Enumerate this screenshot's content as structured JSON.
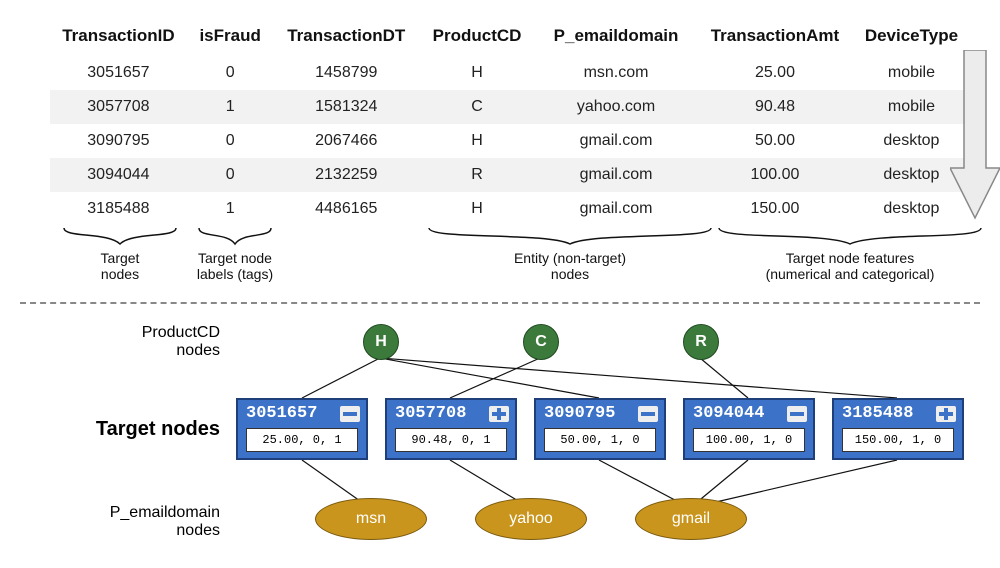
{
  "table": {
    "columns": [
      "TransactionID",
      "isFraud",
      "TransactionDT",
      "ProductCD",
      "P_emaildomain",
      "TransactionAmt",
      "DeviceType"
    ],
    "rows": [
      {
        "tid": "3051657",
        "fraud": "0",
        "dt": "1458799",
        "pcd": "H",
        "email": "msn.com",
        "amt": "25.00",
        "dev": "mobile"
      },
      {
        "tid": "3057708",
        "fraud": "1",
        "dt": "1581324",
        "pcd": "C",
        "email": "yahoo.com",
        "amt": "90.48",
        "dev": "mobile"
      },
      {
        "tid": "3090795",
        "fraud": "0",
        "dt": "2067466",
        "pcd": "H",
        "email": "gmail.com",
        "amt": "50.00",
        "dev": "desktop"
      },
      {
        "tid": "3094044",
        "fraud": "0",
        "dt": "2132259",
        "pcd": "R",
        "email": "gmail.com",
        "amt": "100.00",
        "dev": "desktop"
      },
      {
        "tid": "3185488",
        "fraud": "1",
        "dt": "4486165",
        "pcd": "H",
        "email": "gmail.com",
        "amt": "150.00",
        "dev": "desktop"
      }
    ]
  },
  "braces": {
    "target_nodes": "Target\nnodes",
    "target_labels": "Target node\nlabels (tags)",
    "entity_nodes": "Entity (non-target)\nnodes",
    "target_features": "Target node features\n(numerical and categorical)"
  },
  "graph": {
    "row_labels": {
      "pcd": "ProductCD\nnodes",
      "target": "Target nodes",
      "email": "P_emaildomain\nnodes"
    },
    "pcd_nodes": [
      "H",
      "C",
      "R"
    ],
    "target_nodes": [
      {
        "id": "3051657",
        "mark": "minus",
        "feat": "25.00, 0, 1"
      },
      {
        "id": "3057708",
        "mark": "plus",
        "feat": "90.48, 0, 1"
      },
      {
        "id": "3090795",
        "mark": "minus",
        "feat": "50.00, 1, 0"
      },
      {
        "id": "3094044",
        "mark": "minus",
        "feat": "100.00, 1, 0"
      },
      {
        "id": "3185488",
        "mark": "plus",
        "feat": "150.00, 1, 0"
      }
    ],
    "email_nodes": [
      "msn",
      "yahoo",
      "gmail"
    ]
  },
  "chart_data": {
    "type": "table",
    "title": "Tabular-to-graph mapping example",
    "columns": [
      "TransactionID",
      "isFraud",
      "TransactionDT",
      "ProductCD",
      "P_emaildomain",
      "TransactionAmt",
      "DeviceType"
    ],
    "column_roles": {
      "TransactionID": "target_node",
      "isFraud": "target_label",
      "TransactionDT": "unused",
      "ProductCD": "entity_node",
      "P_emaildomain": "entity_node",
      "TransactionAmt": "target_feature_numeric",
      "DeviceType": "target_feature_categorical"
    },
    "data": [
      {
        "TransactionID": 3051657,
        "isFraud": 0,
        "TransactionDT": 1458799,
        "ProductCD": "H",
        "P_emaildomain": "msn.com",
        "TransactionAmt": 25.0,
        "DeviceType": "mobile"
      },
      {
        "TransactionID": 3057708,
        "isFraud": 1,
        "TransactionDT": 1581324,
        "ProductCD": "C",
        "P_emaildomain": "yahoo.com",
        "TransactionAmt": 90.48,
        "DeviceType": "mobile"
      },
      {
        "TransactionID": 3090795,
        "isFraud": 0,
        "TransactionDT": 2067466,
        "ProductCD": "H",
        "P_emaildomain": "gmail.com",
        "TransactionAmt": 50.0,
        "DeviceType": "desktop"
      },
      {
        "TransactionID": 3094044,
        "isFraud": 0,
        "TransactionDT": 2132259,
        "ProductCD": "R",
        "P_emaildomain": "gmail.com",
        "TransactionAmt": 100.0,
        "DeviceType": "desktop"
      },
      {
        "TransactionID": 3185488,
        "isFraud": 1,
        "TransactionDT": 4486165,
        "ProductCD": "H",
        "P_emaildomain": "gmail.com",
        "TransactionAmt": 150.0,
        "DeviceType": "desktop"
      }
    ],
    "graph": {
      "target_nodes": [
        3051657,
        3057708,
        3090795,
        3094044,
        3185488
      ],
      "target_node_features": {
        "3051657": [
          25.0,
          0,
          1
        ],
        "3057708": [
          90.48,
          0,
          1
        ],
        "3090795": [
          50.0,
          1,
          0
        ],
        "3094044": [
          100.0,
          1,
          0
        ],
        "3185488": [
          150.0,
          1,
          0
        ]
      },
      "target_node_labels": {
        "3051657": 0,
        "3057708": 1,
        "3090795": 0,
        "3094044": 0,
        "3185488": 1
      },
      "productcd_nodes": [
        "H",
        "C",
        "R"
      ],
      "email_nodes": [
        "msn",
        "yahoo",
        "gmail"
      ],
      "edges_productcd": [
        [
          "H",
          3051657
        ],
        [
          "H",
          3090795
        ],
        [
          "H",
          3185488
        ],
        [
          "C",
          3057708
        ],
        [
          "R",
          3094044
        ]
      ],
      "edges_email": [
        [
          "msn",
          3051657
        ],
        [
          "yahoo",
          3057708
        ],
        [
          "gmail",
          3090795
        ],
        [
          "gmail",
          3094044
        ],
        [
          "gmail",
          3185488
        ]
      ]
    }
  }
}
